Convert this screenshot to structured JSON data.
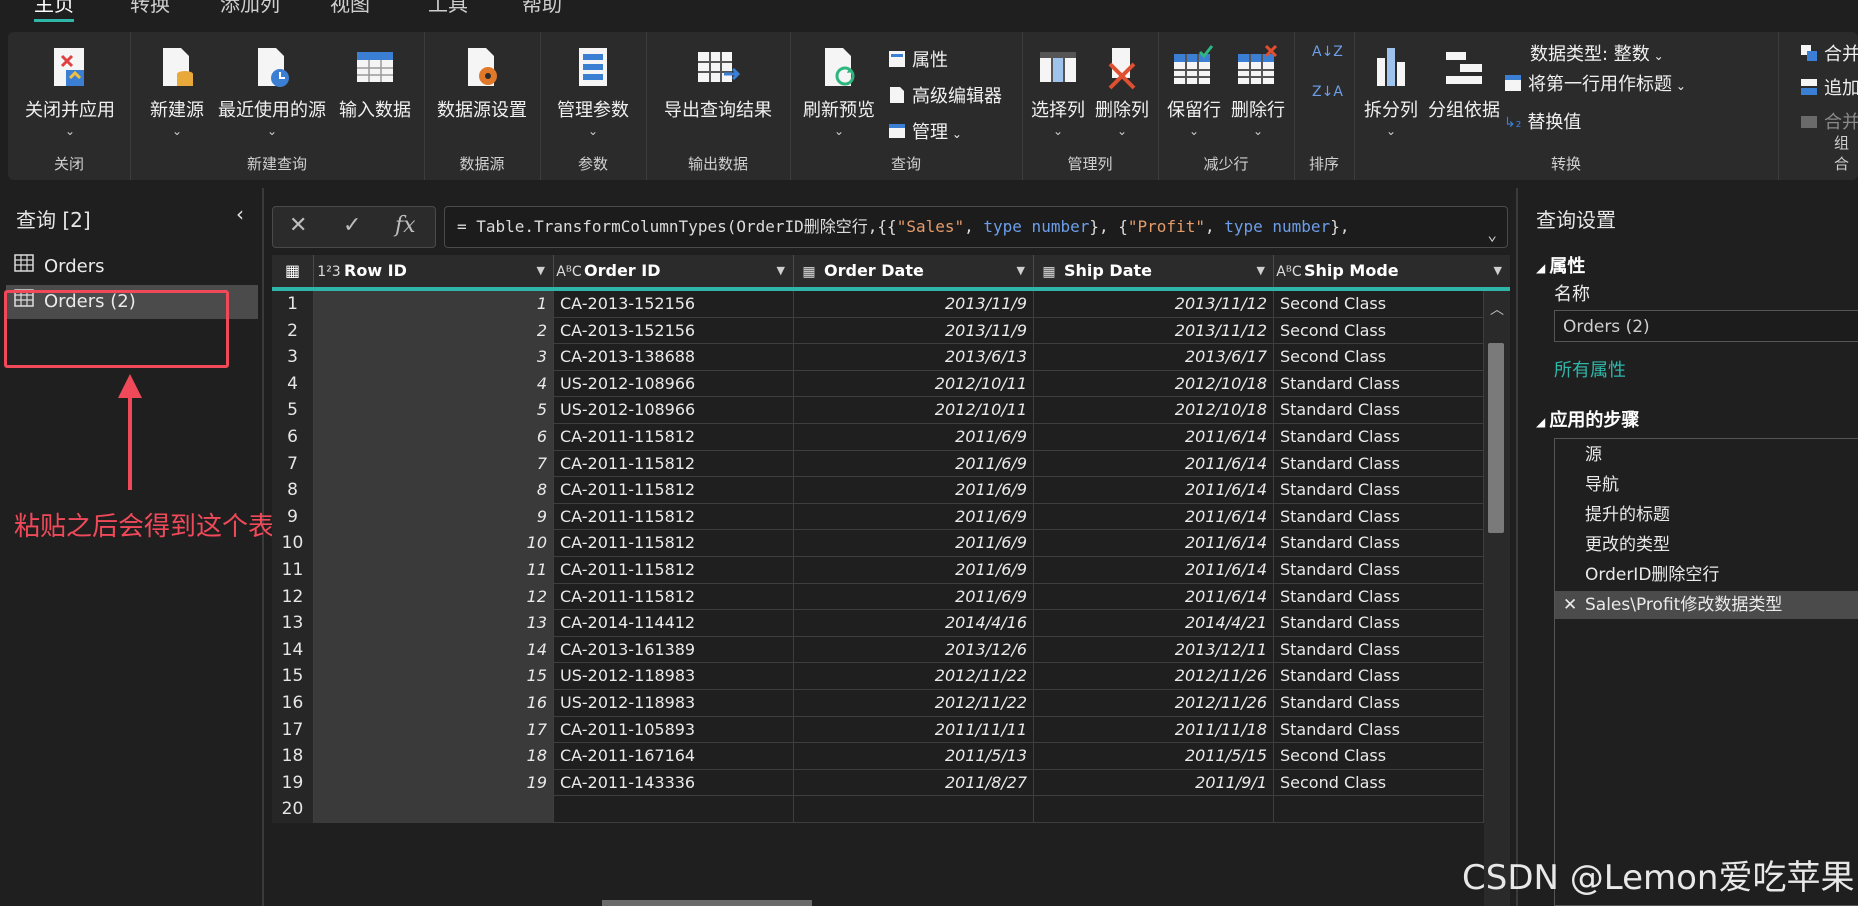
{
  "tabs": [
    "主页",
    "转换",
    "添加列",
    "视图",
    "工具",
    "帮助"
  ],
  "ribbon": {
    "close_group": {
      "label": "关闭",
      "close_apply": "关闭并应用"
    },
    "new_query_group": {
      "label": "新建查询",
      "new_source": "新建源",
      "recent_sources": "最近使用的源",
      "enter_data": "输入数据"
    },
    "datasource_group": {
      "label": "数据源",
      "datasource_settings": "数据源设置"
    },
    "params_group": {
      "label": "参数",
      "manage_params": "管理参数"
    },
    "output_group": {
      "label": "输出数据",
      "export_results": "导出查询结果"
    },
    "query_group": {
      "label": "查询",
      "refresh_preview": "刷新预览",
      "properties": "属性",
      "advanced_editor": "高级编辑器",
      "manage": "管理"
    },
    "manage_cols_group": {
      "label": "管理列",
      "choose_cols": "选择列",
      "remove_cols": "删除列"
    },
    "reduce_rows_group": {
      "label": "减少行",
      "keep_rows": "保留行",
      "remove_rows": "删除行"
    },
    "sort_group": {
      "label": "排序"
    },
    "transform_group": {
      "label": "转换",
      "split_col": "拆分列",
      "group_by": "分组依据",
      "data_type": "数据类型: 整数",
      "first_row_header": "将第一行用作标题",
      "replace_values": "替换值"
    },
    "combine_group": {
      "label": "组合",
      "merge": "合并",
      "append": "追加",
      "combine": "合并"
    }
  },
  "query_pane": {
    "title": "查询 [2]",
    "items": [
      "Orders",
      "Orders (2)"
    ],
    "annotation": "粘贴之后会得到这个表格"
  },
  "formula": {
    "prefix": "= Table.TransformColumnTypes(OrderID删除空行,{{",
    "s1": "\"Sales\"",
    "sep1": ", ",
    "kw1": "type number",
    "mid": "}, {",
    "s2": "\"Profit\"",
    "sep2": ", ",
    "kw2": "type number",
    "suffix": "},"
  },
  "grid": {
    "columns": [
      {
        "type_icon": "1²3",
        "name": "Row ID"
      },
      {
        "type_icon": "AᴮC",
        "name": "Order ID"
      },
      {
        "type_icon": "▦",
        "name": "Order Date"
      },
      {
        "type_icon": "▦",
        "name": "Ship Date"
      },
      {
        "type_icon": "AᴮC",
        "name": "Ship Mode"
      }
    ],
    "rows": [
      [
        "1",
        "1",
        "CA-2013-152156",
        "2013/11/9",
        "2013/11/12",
        "Second Class"
      ],
      [
        "2",
        "2",
        "CA-2013-152156",
        "2013/11/9",
        "2013/11/12",
        "Second Class"
      ],
      [
        "3",
        "3",
        "CA-2013-138688",
        "2013/6/13",
        "2013/6/17",
        "Second Class"
      ],
      [
        "4",
        "4",
        "US-2012-108966",
        "2012/10/11",
        "2012/10/18",
        "Standard Class"
      ],
      [
        "5",
        "5",
        "US-2012-108966",
        "2012/10/11",
        "2012/10/18",
        "Standard Class"
      ],
      [
        "6",
        "6",
        "CA-2011-115812",
        "2011/6/9",
        "2011/6/14",
        "Standard Class"
      ],
      [
        "7",
        "7",
        "CA-2011-115812",
        "2011/6/9",
        "2011/6/14",
        "Standard Class"
      ],
      [
        "8",
        "8",
        "CA-2011-115812",
        "2011/6/9",
        "2011/6/14",
        "Standard Class"
      ],
      [
        "9",
        "9",
        "CA-2011-115812",
        "2011/6/9",
        "2011/6/14",
        "Standard Class"
      ],
      [
        "10",
        "10",
        "CA-2011-115812",
        "2011/6/9",
        "2011/6/14",
        "Standard Class"
      ],
      [
        "11",
        "11",
        "CA-2011-115812",
        "2011/6/9",
        "2011/6/14",
        "Standard Class"
      ],
      [
        "12",
        "12",
        "CA-2011-115812",
        "2011/6/9",
        "2011/6/14",
        "Standard Class"
      ],
      [
        "13",
        "13",
        "CA-2014-114412",
        "2014/4/16",
        "2014/4/21",
        "Standard Class"
      ],
      [
        "14",
        "14",
        "CA-2013-161389",
        "2013/12/6",
        "2013/12/11",
        "Standard Class"
      ],
      [
        "15",
        "15",
        "US-2012-118983",
        "2012/11/22",
        "2012/11/26",
        "Standard Class"
      ],
      [
        "16",
        "16",
        "US-2012-118983",
        "2012/11/22",
        "2012/11/26",
        "Standard Class"
      ],
      [
        "17",
        "17",
        "CA-2011-105893",
        "2011/11/11",
        "2011/11/18",
        "Standard Class"
      ],
      [
        "18",
        "18",
        "CA-2011-167164",
        "2011/5/13",
        "2011/5/15",
        "Second Class"
      ],
      [
        "19",
        "19",
        "CA-2011-143336",
        "2011/8/27",
        "2011/9/1",
        "Second Class"
      ],
      [
        "20",
        "",
        "",
        "",
        "",
        ""
      ]
    ]
  },
  "settings": {
    "title": "查询设置",
    "props_heading": "属性",
    "name_label": "名称",
    "name_value": "Orders (2)",
    "all_props_link": "所有属性",
    "steps_heading": "应用的步骤",
    "steps": [
      "源",
      "导航",
      "提升的标题",
      "更改的类型",
      "OrderID删除空行",
      "Sales\\Profit修改数据类型"
    ]
  },
  "watermark": "CSDN @Lemon爱吃苹果",
  "colors": {
    "accent": "#2fb6a8",
    "annotation": "#f04a5a",
    "background": "#1f1f1f"
  }
}
